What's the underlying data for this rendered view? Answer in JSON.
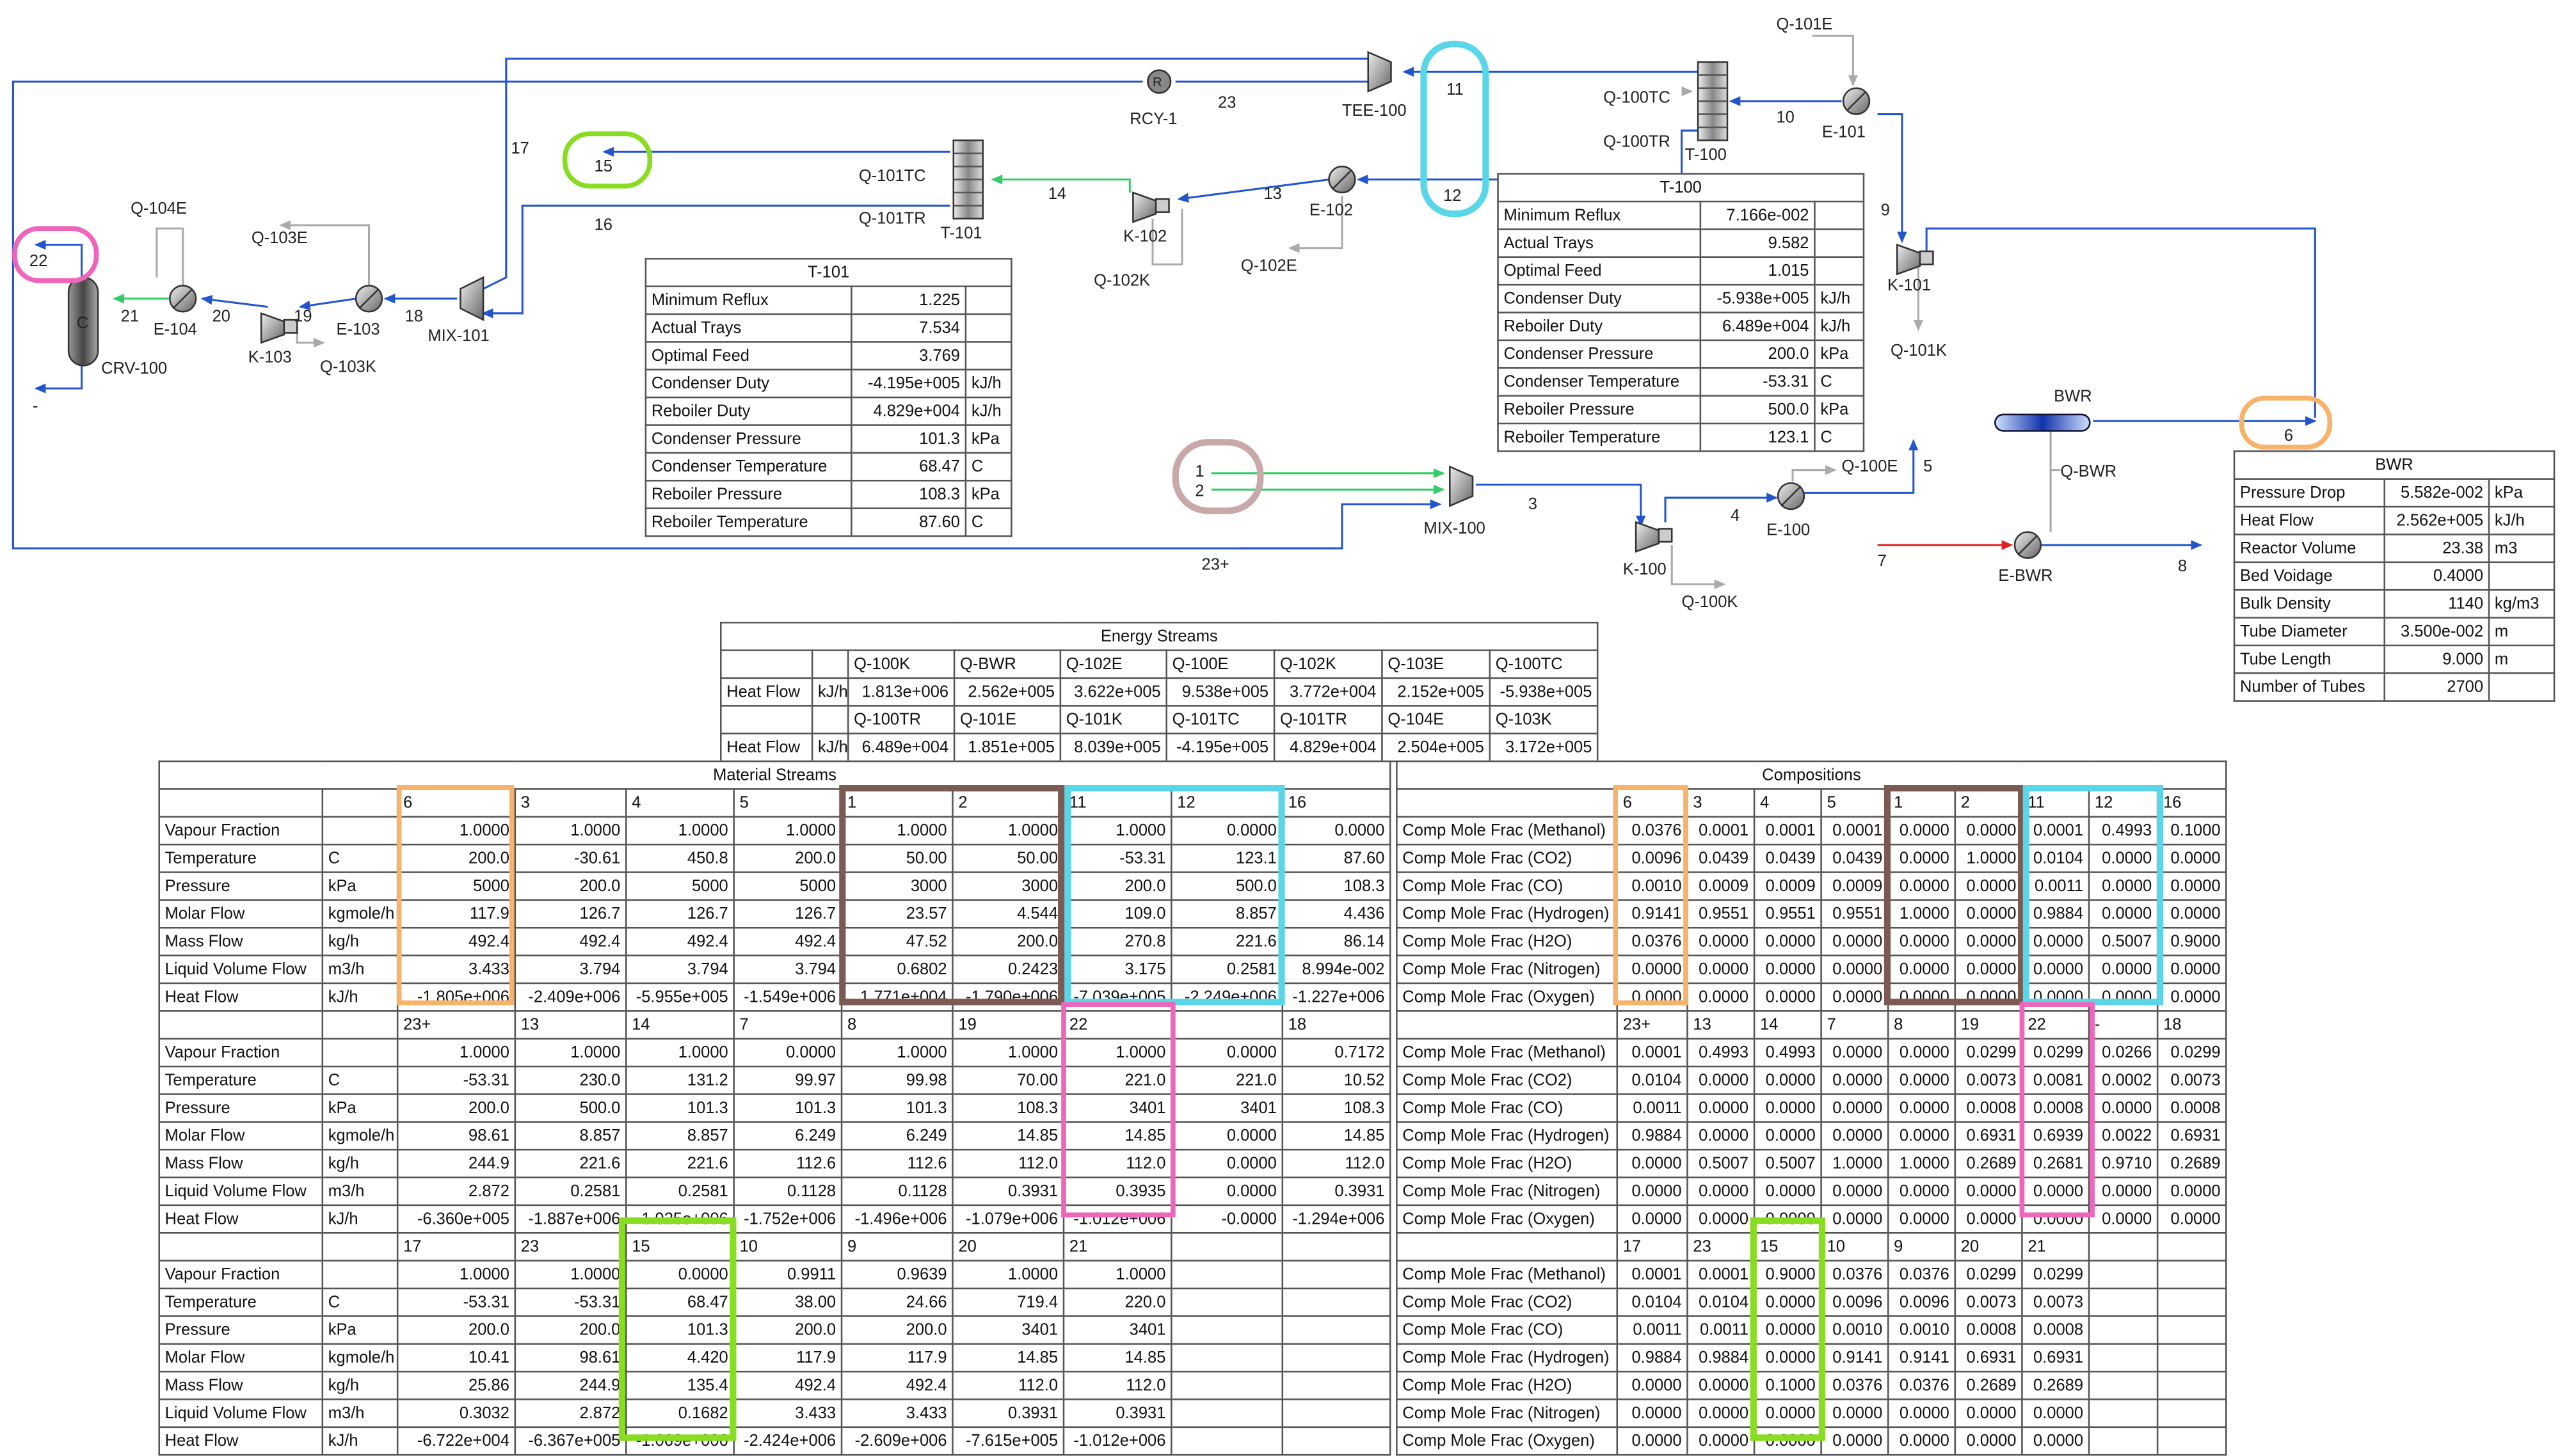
{
  "colors": {
    "material": "#2255cc",
    "energy": "#33cc66",
    "inactive": "#aaaaaa",
    "hot": "#dd2222",
    "orange": "#f7b36a",
    "brown": "#7a5a52",
    "cyan": "#5ad6e8",
    "pink": "#ee66bb",
    "green": "#88dd22",
    "lavender": "#c8a8a8"
  },
  "flowsheet": {
    "units": [
      "TEE-100",
      "RCY-1",
      "T-100",
      "E-101",
      "K-101",
      "T-101",
      "K-102",
      "E-102",
      "MIX-101",
      "E-103",
      "K-103",
      "E-104",
      "CRV-100",
      "MIX-100",
      "K-100",
      "E-100",
      "BWR",
      "E-BWR"
    ],
    "icon_glyphs": {
      "rcy": "R",
      "crv": "C"
    },
    "energy_streams": [
      "Q-101E",
      "Q-100TC",
      "Q-100TR",
      "Q-101K",
      "Q-101TC",
      "Q-101TR",
      "Q-102K",
      "Q-102E",
      "Q-104E",
      "Q-103E",
      "Q-103K",
      "Q-100E",
      "Q-100K",
      "Q-BWR"
    ],
    "streams": [
      "23",
      "11",
      "12",
      "10",
      "9",
      "15",
      "16",
      "14",
      "13",
      "17",
      "22",
      "21",
      "20",
      "19",
      "18",
      "-",
      "1",
      "2",
      "3",
      "4",
      "5",
      "6",
      "7",
      "8",
      "23+"
    ]
  },
  "t101": {
    "title": "T-101",
    "rows": [
      [
        "Minimum Reflux",
        "1.225",
        ""
      ],
      [
        "Actual Trays",
        "7.534",
        ""
      ],
      [
        "Optimal Feed",
        "3.769",
        ""
      ],
      [
        "Condenser Duty",
        "-4.195e+005",
        "kJ/h"
      ],
      [
        "Reboiler Duty",
        "4.829e+004",
        "kJ/h"
      ],
      [
        "Condenser Pressure",
        "101.3",
        "kPa"
      ],
      [
        "Condenser Temperature",
        "68.47",
        "C"
      ],
      [
        "Reboiler Pressure",
        "108.3",
        "kPa"
      ],
      [
        "Reboiler Temperature",
        "87.60",
        "C"
      ]
    ]
  },
  "t100": {
    "title": "T-100",
    "rows": [
      [
        "Minimum Reflux",
        "7.166e-002",
        ""
      ],
      [
        "Actual Trays",
        "9.582",
        ""
      ],
      [
        "Optimal Feed",
        "1.015",
        ""
      ],
      [
        "Condenser Duty",
        "-5.938e+005",
        "kJ/h"
      ],
      [
        "Reboiler Duty",
        "6.489e+004",
        "kJ/h"
      ],
      [
        "Condenser Pressure",
        "200.0",
        "kPa"
      ],
      [
        "Condenser Temperature",
        "-53.31",
        "C"
      ],
      [
        "Reboiler Pressure",
        "500.0",
        "kPa"
      ],
      [
        "Reboiler Temperature",
        "123.1",
        "C"
      ]
    ]
  },
  "bwr": {
    "title": "BWR",
    "rows": [
      [
        "Pressure Drop",
        "5.582e-002",
        "kPa"
      ],
      [
        "Heat Flow",
        "2.562e+005",
        "kJ/h"
      ],
      [
        "Reactor Volume",
        "23.38",
        "m3"
      ],
      [
        "Bed Voidage",
        "0.4000",
        ""
      ],
      [
        "Bulk Density",
        "1140",
        "kg/m3"
      ],
      [
        "Tube Diameter",
        "3.500e-002",
        "m"
      ],
      [
        "Tube Length",
        "9.000",
        "m"
      ],
      [
        "Number of Tubes",
        "2700",
        ""
      ]
    ]
  },
  "energy": {
    "title": "Energy Streams",
    "label": "Heat Flow",
    "unit": "kJ/h",
    "headers1": [
      "Q-100K",
      "Q-BWR",
      "Q-102E",
      "Q-100E",
      "Q-102K",
      "Q-103E",
      "Q-100TC"
    ],
    "values1": [
      "1.813e+006",
      "2.562e+005",
      "3.622e+005",
      "9.538e+005",
      "3.772e+004",
      "2.152e+005",
      "-5.938e+005"
    ],
    "headers2": [
      "Q-100TR",
      "Q-101E",
      "Q-101K",
      "Q-101TC",
      "Q-101TR",
      "Q-104E",
      "Q-103K"
    ],
    "values2": [
      "6.489e+004",
      "1.851e+005",
      "8.039e+005",
      "-4.195e+005",
      "4.829e+004",
      "2.504e+005",
      "3.172e+005"
    ]
  },
  "material": {
    "title": "Material Streams",
    "props": [
      "Vapour Fraction",
      "Temperature",
      "Pressure",
      "Molar Flow",
      "Mass Flow",
      "Liquid Volume Flow",
      "Heat Flow"
    ],
    "units": [
      "",
      "C",
      "kPa",
      "kgmole/h",
      "kg/h",
      "m3/h",
      "kJ/h"
    ],
    "blocks": [
      {
        "headers": [
          "6",
          "3",
          "4",
          "5",
          "1",
          "2",
          "11",
          "12",
          "16"
        ],
        "rows": [
          [
            "1.0000",
            "1.0000",
            "1.0000",
            "1.0000",
            "1.0000",
            "1.0000",
            "1.0000",
            "0.0000",
            "0.0000"
          ],
          [
            "200.0",
            "-30.61",
            "450.8",
            "200.0",
            "50.00",
            "50.00",
            "-53.31",
            "123.1",
            "87.60"
          ],
          [
            "5000",
            "200.0",
            "5000",
            "5000",
            "3000",
            "3000",
            "200.0",
            "500.0",
            "108.3"
          ],
          [
            "117.9",
            "126.7",
            "126.7",
            "126.7",
            "23.57",
            "4.544",
            "109.0",
            "8.857",
            "4.436"
          ],
          [
            "492.4",
            "492.4",
            "492.4",
            "492.4",
            "47.52",
            "200.0",
            "270.8",
            "221.6",
            "86.14"
          ],
          [
            "3.433",
            "3.794",
            "3.794",
            "3.794",
            "0.6802",
            "0.2423",
            "3.175",
            "0.2581",
            "8.994e-002"
          ],
          [
            "-1.805e+006",
            "-2.409e+006",
            "-5.955e+005",
            "-1.549e+006",
            "1.771e+004",
            "-1.790e+006",
            "-7.039e+005",
            "-2.249e+006",
            "-1.227e+006"
          ]
        ]
      },
      {
        "headers": [
          "23+",
          "13",
          "14",
          "7",
          "8",
          "19",
          "22",
          "",
          "18"
        ],
        "rows": [
          [
            "1.0000",
            "1.0000",
            "1.0000",
            "0.0000",
            "1.0000",
            "1.0000",
            "1.0000",
            "0.0000",
            "0.7172"
          ],
          [
            "-53.31",
            "230.0",
            "131.2",
            "99.97",
            "99.98",
            "70.00",
            "221.0",
            "221.0",
            "10.52"
          ],
          [
            "200.0",
            "500.0",
            "101.3",
            "101.3",
            "101.3",
            "108.3",
            "3401",
            "3401",
            "108.3"
          ],
          [
            "98.61",
            "8.857",
            "8.857",
            "6.249",
            "6.249",
            "14.85",
            "14.85",
            "0.0000",
            "14.85"
          ],
          [
            "244.9",
            "221.6",
            "221.6",
            "112.6",
            "112.6",
            "112.0",
            "112.0",
            "0.0000",
            "112.0"
          ],
          [
            "2.872",
            "0.2581",
            "0.2581",
            "0.1128",
            "0.1128",
            "0.3931",
            "0.3935",
            "0.0000",
            "0.3931"
          ],
          [
            "-6.360e+005",
            "-1.887e+006",
            "-1.925e+006",
            "-1.752e+006",
            "-1.496e+006",
            "-1.079e+006",
            "-1.012e+006",
            "-0.0000",
            "-1.294e+006"
          ]
        ]
      },
      {
        "headers": [
          "17",
          "23",
          "15",
          "10",
          "9",
          "20",
          "21",
          "",
          ""
        ],
        "rows": [
          [
            "1.0000",
            "1.0000",
            "0.0000",
            "0.9911",
            "0.9639",
            "1.0000",
            "1.0000",
            "",
            ""
          ],
          [
            "-53.31",
            "-53.31",
            "68.47",
            "38.00",
            "24.66",
            "719.4",
            "220.0",
            "",
            ""
          ],
          [
            "200.0",
            "200.0",
            "101.3",
            "200.0",
            "200.0",
            "3401",
            "3401",
            "",
            ""
          ],
          [
            "10.41",
            "98.61",
            "4.420",
            "117.9",
            "117.9",
            "14.85",
            "14.85",
            "",
            ""
          ],
          [
            "25.86",
            "244.9",
            "135.4",
            "492.4",
            "492.4",
            "112.0",
            "112.0",
            "",
            ""
          ],
          [
            "0.3032",
            "2.872",
            "0.1682",
            "3.433",
            "3.433",
            "0.3931",
            "0.3931",
            "",
            ""
          ],
          [
            "-6.722e+004",
            "-6.367e+005",
            "-1.069e+006",
            "-2.424e+006",
            "-2.609e+006",
            "-7.615e+005",
            "-1.012e+006",
            "",
            ""
          ]
        ]
      }
    ]
  },
  "compositions": {
    "title": "Compositions",
    "props": [
      "Comp Mole Frac (Methanol)",
      "Comp Mole Frac (CO2)",
      "Comp Mole Frac (CO)",
      "Comp Mole Frac (Hydrogen)",
      "Comp Mole Frac (H2O)",
      "Comp Mole Frac (Nitrogen)",
      "Comp Mole Frac (Oxygen)"
    ],
    "blocks": [
      {
        "headers": [
          "6",
          "3",
          "4",
          "5",
          "1",
          "2",
          "11",
          "12",
          "16"
        ],
        "rows": [
          [
            "0.0376",
            "0.0001",
            "0.0001",
            "0.0001",
            "0.0000",
            "0.0000",
            "0.0001",
            "0.4993",
            "0.1000"
          ],
          [
            "0.0096",
            "0.0439",
            "0.0439",
            "0.0439",
            "0.0000",
            "1.0000",
            "0.0104",
            "0.0000",
            "0.0000"
          ],
          [
            "0.0010",
            "0.0009",
            "0.0009",
            "0.0009",
            "0.0000",
            "0.0000",
            "0.0011",
            "0.0000",
            "0.0000"
          ],
          [
            "0.9141",
            "0.9551",
            "0.9551",
            "0.9551",
            "1.0000",
            "0.0000",
            "0.9884",
            "0.0000",
            "0.0000"
          ],
          [
            "0.0376",
            "0.0000",
            "0.0000",
            "0.0000",
            "0.0000",
            "0.0000",
            "0.0000",
            "0.5007",
            "0.9000"
          ],
          [
            "0.0000",
            "0.0000",
            "0.0000",
            "0.0000",
            "0.0000",
            "0.0000",
            "0.0000",
            "0.0000",
            "0.0000"
          ],
          [
            "0.0000",
            "0.0000",
            "0.0000",
            "0.0000",
            "0.0000",
            "0.0000",
            "0.0000",
            "0.0000",
            "0.0000"
          ]
        ]
      },
      {
        "headers": [
          "23+",
          "13",
          "14",
          "7",
          "8",
          "19",
          "22",
          "-",
          "18"
        ],
        "rows": [
          [
            "0.0001",
            "0.4993",
            "0.4993",
            "0.0000",
            "0.0000",
            "0.0299",
            "0.0299",
            "0.0266",
            "0.0299"
          ],
          [
            "0.0104",
            "0.0000",
            "0.0000",
            "0.0000",
            "0.0000",
            "0.0073",
            "0.0081",
            "0.0002",
            "0.0073"
          ],
          [
            "0.0011",
            "0.0000",
            "0.0000",
            "0.0000",
            "0.0000",
            "0.0008",
            "0.0008",
            "0.0000",
            "0.0008"
          ],
          [
            "0.9884",
            "0.0000",
            "0.0000",
            "0.0000",
            "0.0000",
            "0.6931",
            "0.6939",
            "0.0022",
            "0.6931"
          ],
          [
            "0.0000",
            "0.5007",
            "0.5007",
            "1.0000",
            "1.0000",
            "0.2689",
            "0.2681",
            "0.9710",
            "0.2689"
          ],
          [
            "0.0000",
            "0.0000",
            "0.0000",
            "0.0000",
            "0.0000",
            "0.0000",
            "0.0000",
            "0.0000",
            "0.0000"
          ],
          [
            "0.0000",
            "0.0000",
            "0.0000",
            "0.0000",
            "0.0000",
            "0.0000",
            "0.0000",
            "0.0000",
            "0.0000"
          ]
        ]
      },
      {
        "headers": [
          "17",
          "23",
          "15",
          "10",
          "9",
          "20",
          "21",
          "",
          ""
        ],
        "rows": [
          [
            "0.0001",
            "0.0001",
            "0.9000",
            "0.0376",
            "0.0376",
            "0.0299",
            "0.0299",
            "",
            ""
          ],
          [
            "0.0104",
            "0.0104",
            "0.0000",
            "0.0096",
            "0.0096",
            "0.0073",
            "0.0073",
            "",
            ""
          ],
          [
            "0.0011",
            "0.0011",
            "0.0000",
            "0.0010",
            "0.0010",
            "0.0008",
            "0.0008",
            "",
            ""
          ],
          [
            "0.9884",
            "0.9884",
            "0.0000",
            "0.9141",
            "0.9141",
            "0.6931",
            "0.6931",
            "",
            ""
          ],
          [
            "0.0000",
            "0.0000",
            "0.1000",
            "0.0376",
            "0.0376",
            "0.2689",
            "0.2689",
            "",
            ""
          ],
          [
            "0.0000",
            "0.0000",
            "0.0000",
            "0.0000",
            "0.0000",
            "0.0000",
            "0.0000",
            "",
            ""
          ],
          [
            "0.0000",
            "0.0000",
            "0.0000",
            "0.0000",
            "0.0000",
            "0.0000",
            "0.0000",
            "",
            ""
          ]
        ]
      }
    ]
  }
}
